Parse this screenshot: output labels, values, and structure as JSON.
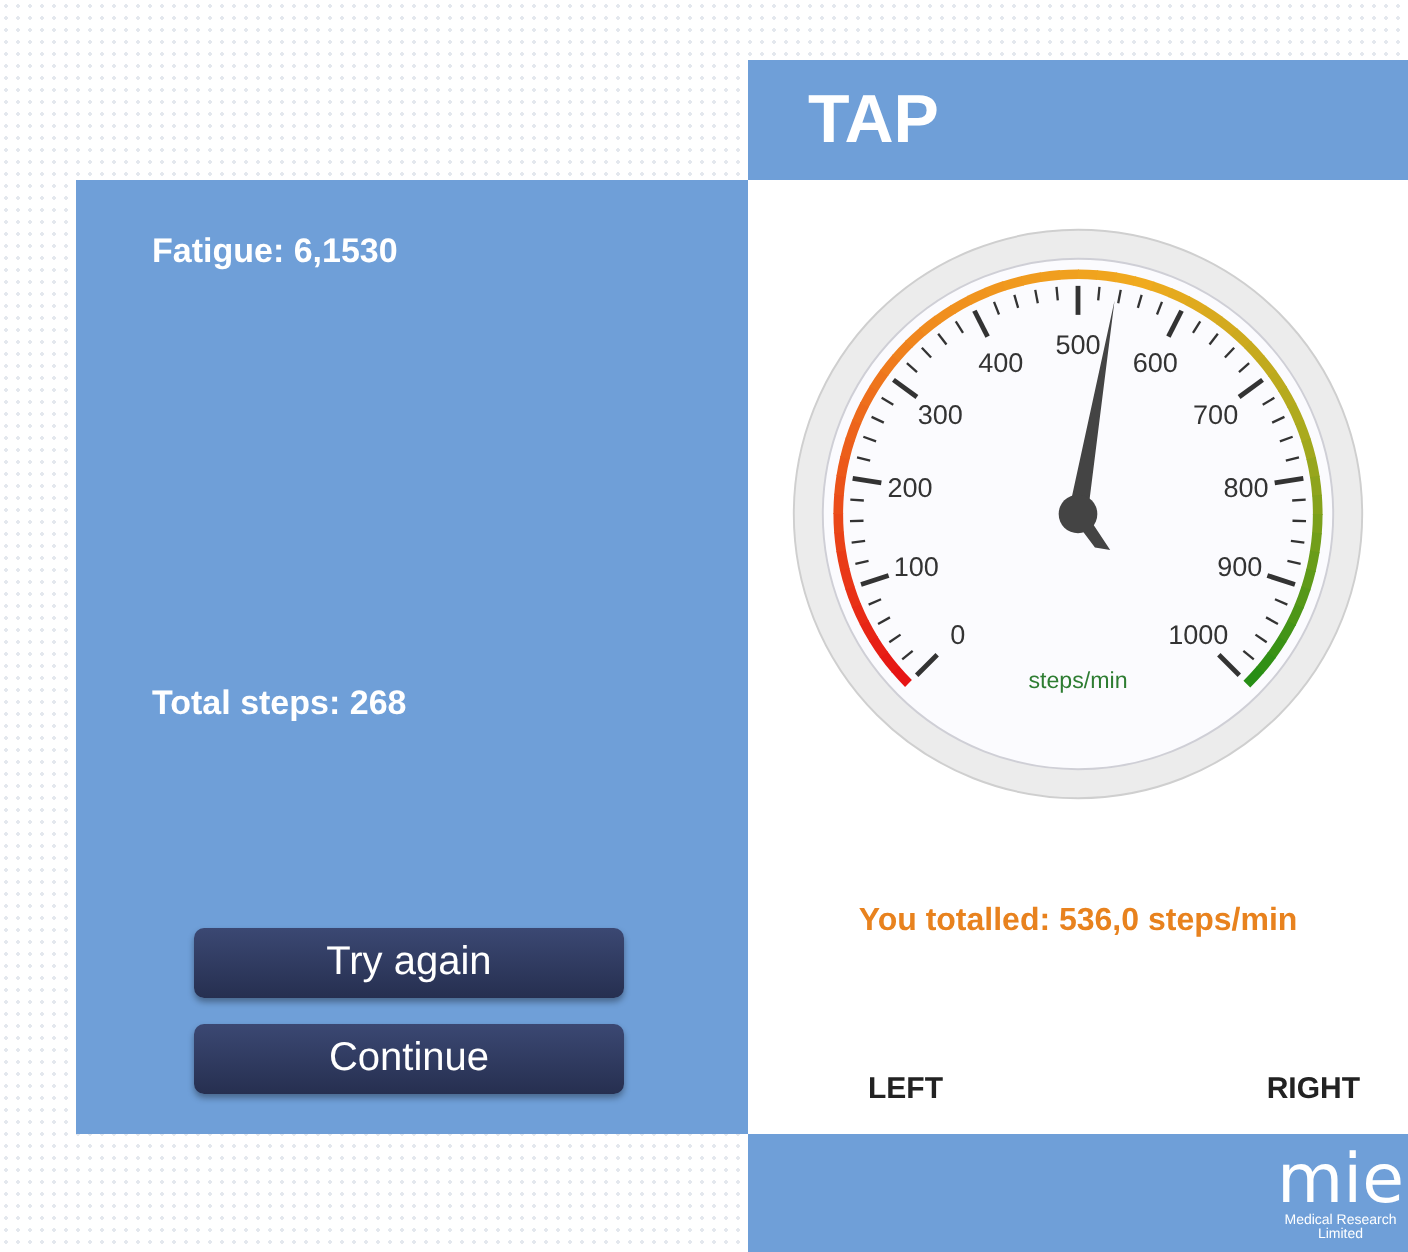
{
  "header": {
    "title": "TAP"
  },
  "results": {
    "fatigue": "Fatigue: 6,1530",
    "total_steps": "Total steps: 268"
  },
  "buttons": [
    "Try again",
    "Continue"
  ],
  "gauge": {
    "level": 0.536,
    "unit": "steps/min",
    "scale_labels": [
      "0",
      "100",
      "200",
      "300",
      "400",
      "500",
      "600",
      "700",
      "800",
      "900",
      "1000"
    ]
  },
  "summary": "You totalled: 536,0 steps/min",
  "sides": [
    "LEFT",
    "RIGHT"
  ],
  "footer": {
    "logo": "mie",
    "logo_caption": "Medical Research",
    "logo_caption_2": "Limited"
  }
}
